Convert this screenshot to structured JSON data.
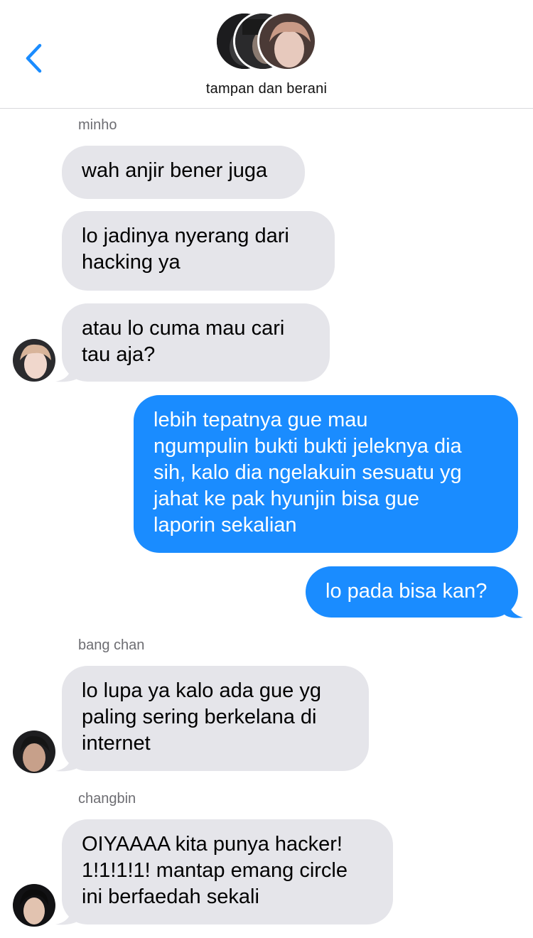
{
  "header": {
    "back_icon": "chevron-left-icon",
    "title": "tampan dan berani",
    "accent_color": "#1a8cff"
  },
  "messages": [
    {
      "sender": "minho",
      "text": "wah anjir bener juga",
      "direction": "incoming"
    },
    {
      "text": "lo jadinya nyerang dari\nhacking ya",
      "direction": "incoming"
    },
    {
      "text": "atau lo cuma mau cari\ntau aja?",
      "direction": "incoming"
    },
    {
      "text": "lebih tepatnya gue mau\nngumpulin bukti bukti jeleknya dia\nsih, kalo dia ngelakuin sesuatu yg\njahat ke pak hyunjin bisa gue\nlaporin sekalian",
      "direction": "outgoing"
    },
    {
      "text": "lo pada bisa kan?",
      "direction": "outgoing"
    },
    {
      "sender": "bang chan",
      "text": "lo lupa ya kalo ada gue yg\npaling sering berkelana di\ninternet",
      "direction": "incoming"
    },
    {
      "sender": "changbin",
      "text": "OIYAAAA kita punya hacker!\n1!1!1!1! mantap emang circle\nini berfaedah sekali",
      "direction": "incoming"
    }
  ],
  "colors": {
    "incoming_bubble": "#e5e5ea",
    "outgoing_bubble": "#1a8cff",
    "sender_label": "#6d6d72"
  }
}
